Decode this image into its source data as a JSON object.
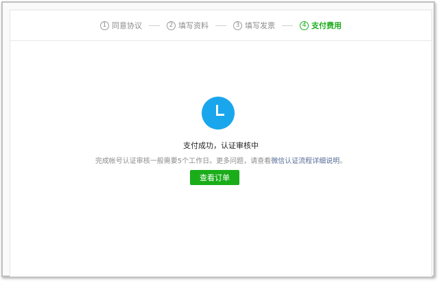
{
  "steps": [
    {
      "number": "1",
      "label": "同意协议",
      "active": false
    },
    {
      "number": "2",
      "label": "填写资料",
      "active": false
    },
    {
      "number": "3",
      "label": "填写发票",
      "active": false
    },
    {
      "number": "4",
      "label": "支付费用",
      "active": true
    }
  ],
  "status": {
    "icon": "clock-icon",
    "title": "支付成功，认证审核中",
    "description_prefix": "完成帐号认证审核一般需要5个工作日。更多问题，请查看",
    "description_link": "微信认证流程详细说明",
    "description_suffix": "。"
  },
  "actions": {
    "view_order_label": "查看订单"
  },
  "colors": {
    "accent": "#1aad19",
    "icon_blue": "#1aa6ec",
    "link": "#576b95",
    "muted_text": "#8c8c8c"
  }
}
